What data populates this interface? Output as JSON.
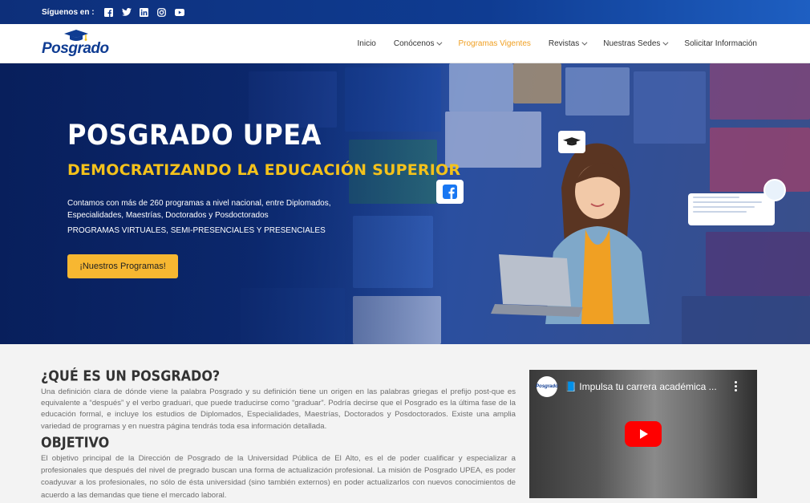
{
  "topbar": {
    "follow_label": "Síguenos en :",
    "social_icons": [
      "facebook-icon",
      "twitter-icon",
      "linkedin-icon",
      "instagram-icon",
      "youtube-icon"
    ]
  },
  "header": {
    "logo_text": "Posgrado",
    "nav": [
      {
        "label": "Inicio",
        "has_dropdown": false,
        "active": false
      },
      {
        "label": "Conócenos",
        "has_dropdown": true,
        "active": false
      },
      {
        "label": "Programas Vigentes",
        "has_dropdown": false,
        "active": true
      },
      {
        "label": "Revistas",
        "has_dropdown": true,
        "active": false
      },
      {
        "label": "Nuestras Sedes",
        "has_dropdown": true,
        "active": false
      },
      {
        "label": "Solicitar Información",
        "has_dropdown": false,
        "active": false
      }
    ],
    "active_color": "#f0a023"
  },
  "hero": {
    "title": "POSGRADO UPEA",
    "subtitle": "DEMOCRATIZANDO LA EDUCACIÓN SUPERIOR",
    "description": "Contamos con más de 260 programas a nivel nacional, entre Diplomados, Especialidades, Maestrías, Doctorados y Posdoctorados",
    "modes": "PROGRAMAS VIRTUALES, SEMI-PRESENCIALES Y PRESENCIALES",
    "cta_label": "¡Nuestros Programas!",
    "accent_color": "#f4c21b"
  },
  "content": {
    "what_title": "¿QUÉ ES UN POSGRADO?",
    "what_text": "Una definición clara de dónde viene la palabra Posgrado y su definición tiene un origen en las palabras griegas el prefijo post-que es equivalente a “después” y el verbo graduari, que puede traducirse como “graduar”. Podría decirse que el Posgrado es la última fase de la educación formal, e incluye los estudios de Diplomados, Especialidades, Maestrías, Doctorados y Posdoctorados. Existe una amplia variedad de programas y en nuestra página tendrás toda esa información detallada.",
    "objective_title": "OBJETIVO",
    "objective_text": "El objetivo principal de la Dirección de Posgrado de la Universidad Pública de El Alto, es el de poder cualificar y especializar a profesionales que después del nivel de pregrado buscan una forma de actualización profesional. La misión de Posgrado UPEA, es poder coadyuvar a los profesionales, no sólo de ésta universidad (sino también externos) en poder actualizarlos con nuevos conocimientos de acuerdo a las demandas que tiene el mercado laboral."
  },
  "video": {
    "channel_logo": "Posgrado",
    "title": "📘 Impulsa tu carrera académica ..."
  }
}
